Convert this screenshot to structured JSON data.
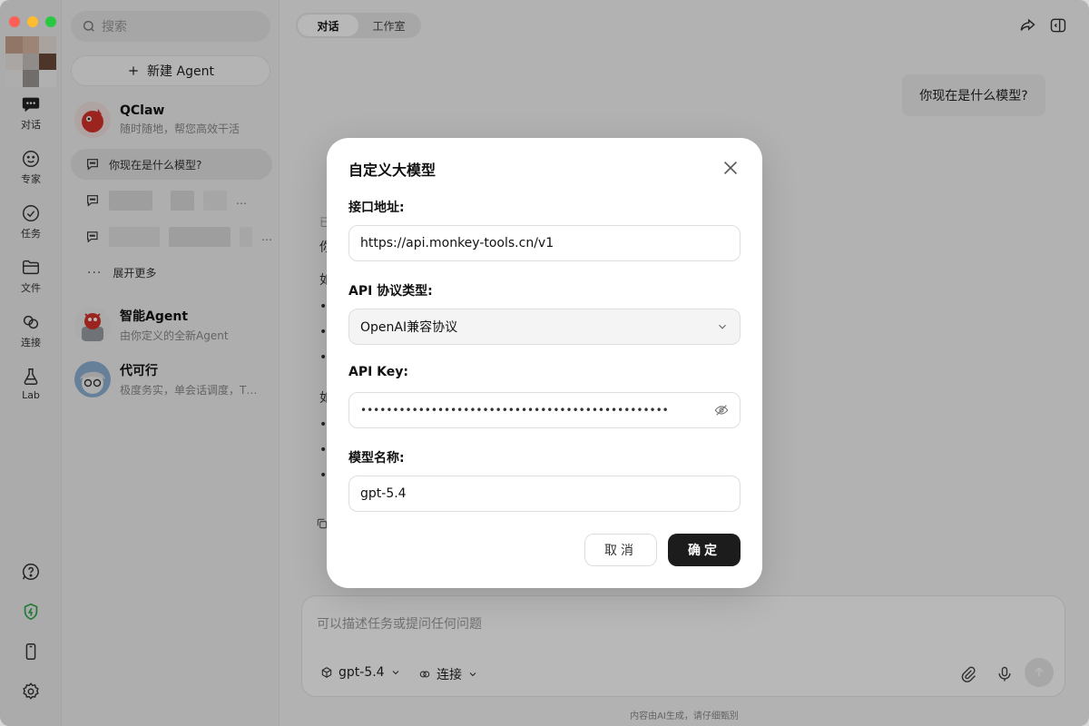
{
  "rail": {
    "items": [
      {
        "label": "对话"
      },
      {
        "label": "专家"
      },
      {
        "label": "任务"
      },
      {
        "label": "文件"
      },
      {
        "label": "连接"
      },
      {
        "label": "Lab"
      }
    ]
  },
  "sidebar": {
    "search_placeholder": "搜索",
    "new_agent_label": "新建 Agent",
    "agents_top": {
      "name": "QClaw",
      "desc": "随时随地，帮您高效干活"
    },
    "chats": [
      {
        "title": "你现在是什么模型?"
      },
      {
        "title": "…"
      },
      {
        "title": "…"
      }
    ],
    "expand_more": "展开更多",
    "agents": [
      {
        "name": "智能Agent",
        "desc": "由你定义的全新Agent"
      },
      {
        "name": "代可行",
        "desc": "极度务实，单会话调度，T…"
      }
    ]
  },
  "main": {
    "tabs": [
      "对话",
      "工作室"
    ],
    "user_message": "你现在是什么模型?",
    "partial_lines": [
      "已",
      "你",
      "如",
      "•",
      "•",
      "•",
      "如",
      "•",
      "•",
      "•"
    ],
    "composer": {
      "placeholder": "可以描述任务或提问任何问题",
      "model_label": "gpt-5.4",
      "connect_label": "连接"
    },
    "footnote": "内容由AI生成，请仔细甄别"
  },
  "modal": {
    "title": "自定义大模型",
    "endpoint_label": "接口地址:",
    "endpoint_value": "https://api.monkey-tools.cn/v1",
    "protocol_label": "API 协议类型:",
    "protocol_value": "OpenAI兼容协议",
    "apikey_label": "API Key:",
    "apikey_value": "••••••••••••••••••••••••••••••••••••••••••••••••",
    "model_label": "模型名称:",
    "model_value": "gpt-5.4",
    "cancel_label": "取消",
    "ok_label": "确定"
  },
  "colors": {
    "accent_dark": "#1c1c1c",
    "security_green": "#2aa84a"
  }
}
